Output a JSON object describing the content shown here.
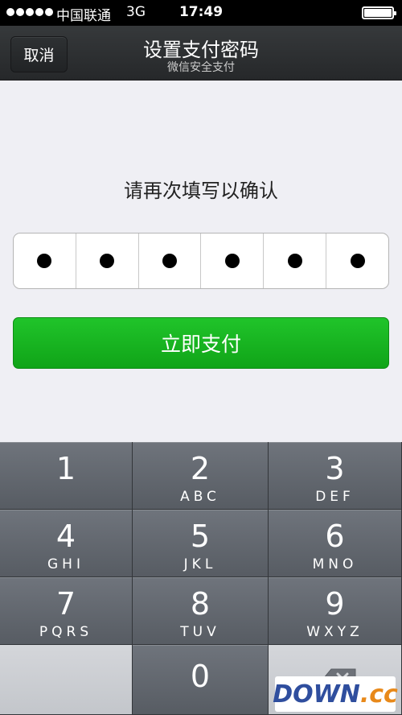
{
  "status_bar": {
    "carrier": "中国联通",
    "network": "3G",
    "time": "17:49"
  },
  "nav": {
    "cancel_label": "取消",
    "title": "设置支付密码",
    "subtitle": "微信安全支付"
  },
  "prompt": "请再次填写以确认",
  "pin": {
    "length": 6,
    "filled": 6
  },
  "pay_button_label": "立即支付",
  "keypad": [
    {
      "digit": "1",
      "letters": ""
    },
    {
      "digit": "2",
      "letters": "ABC"
    },
    {
      "digit": "3",
      "letters": "DEF"
    },
    {
      "digit": "4",
      "letters": "GHI"
    },
    {
      "digit": "5",
      "letters": "JKL"
    },
    {
      "digit": "6",
      "letters": "MNO"
    },
    {
      "digit": "7",
      "letters": "PQRS"
    },
    {
      "digit": "8",
      "letters": "TUV"
    },
    {
      "digit": "9",
      "letters": "WXYZ"
    },
    {
      "digit": "0",
      "letters": ""
    }
  ],
  "watermark": {
    "part1": "DOWN",
    "part2": ".cc"
  },
  "icons": {
    "delete": "backspace-icon"
  },
  "colors": {
    "accent_green": "#1ab620",
    "nav_bg": "#2e3133",
    "keypad_key": "#646970"
  }
}
